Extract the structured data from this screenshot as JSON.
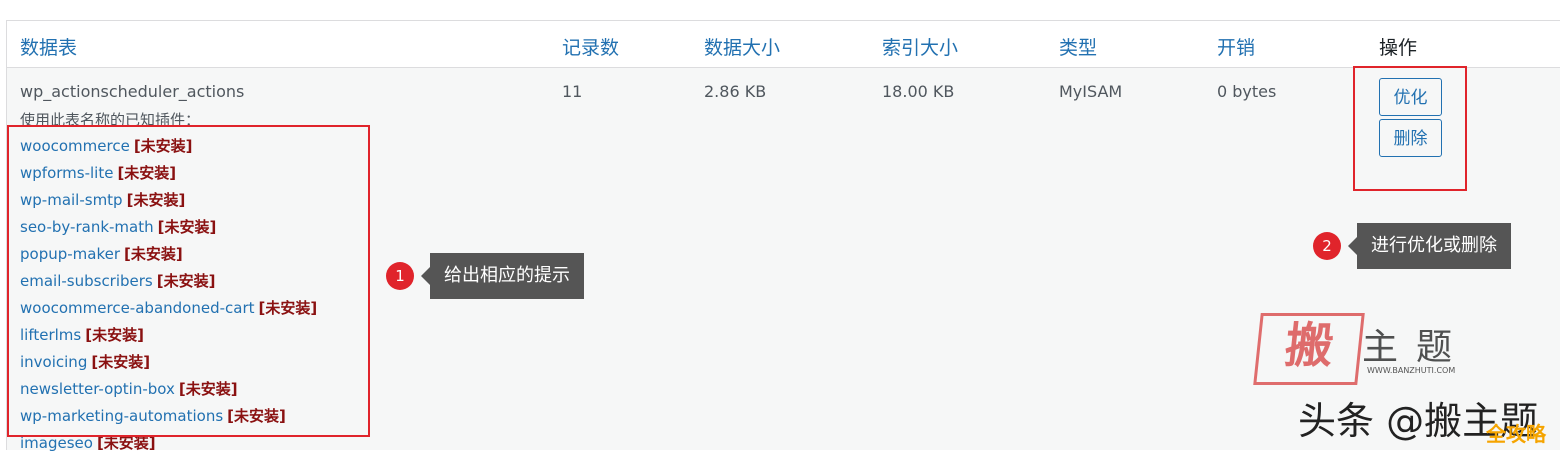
{
  "table": {
    "headers": [
      "数据表",
      "记录数",
      "数据大小",
      "索引大小",
      "类型",
      "开销",
      "操作"
    ],
    "row": {
      "name": "wp_actionscheduler_actions",
      "records": "11",
      "data_size": "2.86 KB",
      "index_size": "18.00 KB",
      "type": "MyISAM",
      "overhead": "0 bytes",
      "plugins_label": "使用此表名称的已知插件：",
      "plugins": [
        {
          "name": "woocommerce",
          "status": "[未安装]"
        },
        {
          "name": "wpforms-lite",
          "status": "[未安装]"
        },
        {
          "name": "wp-mail-smtp",
          "status": "[未安装]"
        },
        {
          "name": "seo-by-rank-math",
          "status": "[未安装]"
        },
        {
          "name": "popup-maker",
          "status": "[未安装]"
        },
        {
          "name": "email-subscribers",
          "status": "[未安装]"
        },
        {
          "name": "woocommerce-abandoned-cart",
          "status": "[未安装]"
        },
        {
          "name": "lifterlms",
          "status": "[未安装]"
        },
        {
          "name": "invoicing",
          "status": "[未安装]"
        },
        {
          "name": "newsletter-optin-box",
          "status": "[未安装]"
        },
        {
          "name": "wp-marketing-automations",
          "status": "[未安装]"
        },
        {
          "name": "imageseo",
          "status": "[未安装]"
        }
      ],
      "actions": {
        "optimize": "优化",
        "delete": "删除"
      }
    }
  },
  "annotations": [
    {
      "number": "1",
      "text": "给出相应的提示"
    },
    {
      "number": "2",
      "text": "进行优化或删除"
    }
  ],
  "watermarks": {
    "stamp": "搬",
    "brand": "主题",
    "url": "WWW.BANZHUTI.COM",
    "toutiao": "头条 @搬主题",
    "corner": "全攻略"
  },
  "colors": {
    "link": "#2271b1",
    "not_installed": "#8a1111",
    "highlight": "#e0242b",
    "callout_bg": "#555555"
  }
}
